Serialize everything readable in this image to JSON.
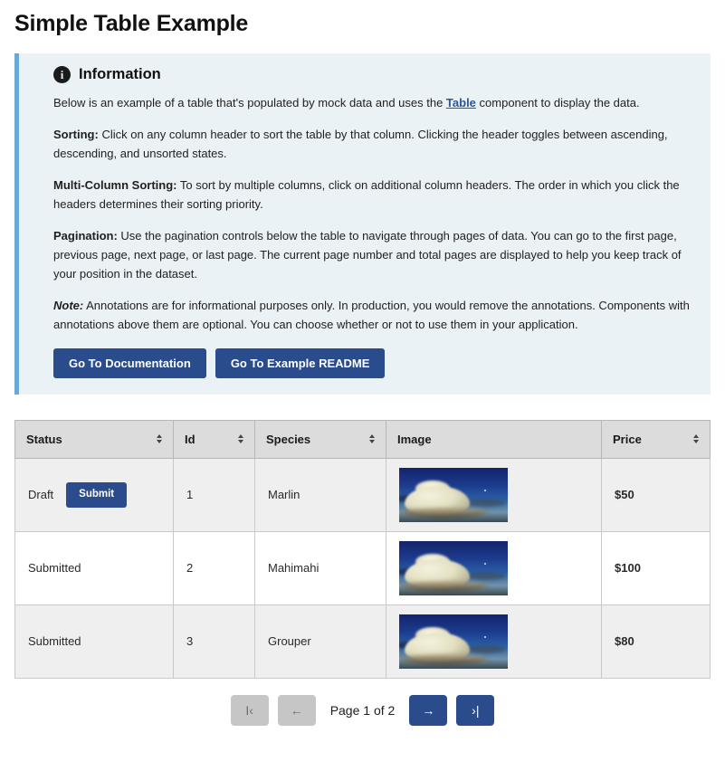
{
  "page": {
    "title": "Simple Table Example"
  },
  "info": {
    "icon": "info-circle-icon",
    "icon_glyph": "i",
    "title": "Information",
    "intro_before_link": "Below is an example of a table that's populated by mock data and uses the ",
    "intro_link": "Table",
    "intro_after_link": " component to display the data.",
    "sorting_label": "Sorting:",
    "sorting_text": " Click on any column header to sort the table by that column. Clicking the header toggles between ascending, descending, and unsorted states.",
    "multi_label": "Multi-Column Sorting:",
    "multi_text": " To sort by multiple columns, click on additional column headers. The order in which you click the headers determines their sorting priority.",
    "pagination_label": "Pagination:",
    "pagination_text": " Use the pagination controls below the table to navigate through pages of data. You can go to the first page, previous page, next page, or last page. The current page number and total pages are displayed to help you keep track of your position in the dataset.",
    "note_label": "Note:",
    "note_text": " Annotations are for informational purposes only. In production, you would remove the annotations. Components with annotations above them are optional. You can choose whether or not to use them in your application.",
    "buttons": [
      {
        "label": "Go To Documentation"
      },
      {
        "label": "Go To Example README"
      }
    ],
    "accent_color": "#6aa9d6",
    "background_color": "#eaf2f5"
  },
  "table": {
    "columns": [
      {
        "label": "Status",
        "sortable": true,
        "sort_icon": "sort-chevrons-icon"
      },
      {
        "label": "Id",
        "sortable": true,
        "sort_icon": "sort-chevrons-icon"
      },
      {
        "label": "Species",
        "sortable": true,
        "sort_icon": "sort-chevrons-icon"
      },
      {
        "label": "Image",
        "sortable": false,
        "sort_icon": ""
      },
      {
        "label": "Price",
        "sortable": true,
        "sort_icon": "sort-chevrons-icon"
      }
    ],
    "rows": [
      {
        "status": "Draft",
        "action_label": "Submit",
        "has_action": true,
        "id": "1",
        "species": "Marlin",
        "image_alt": "cloud-photo-thumbnail",
        "price": "$50"
      },
      {
        "status": "Submitted",
        "action_label": "",
        "has_action": false,
        "id": "2",
        "species": "Mahimahi",
        "image_alt": "cloud-photo-thumbnail",
        "price": "$100"
      },
      {
        "status": "Submitted",
        "action_label": "",
        "has_action": false,
        "id": "3",
        "species": "Grouper",
        "image_alt": "cloud-photo-thumbnail",
        "price": "$80"
      }
    ],
    "header_background": "#dcdcdc",
    "alt_row_background": "#efefef"
  },
  "pagination": {
    "first_label": "I‹",
    "prev_label": "←",
    "page_label": "Page 1 of 2",
    "next_label": "→",
    "last_label": "›|",
    "first_disabled": true,
    "prev_disabled": true,
    "next_disabled": false,
    "last_disabled": false,
    "current_page": 1,
    "total_pages": 2,
    "accent_color": "#2b4c8c",
    "disabled_color": "#c6c6c6"
  }
}
